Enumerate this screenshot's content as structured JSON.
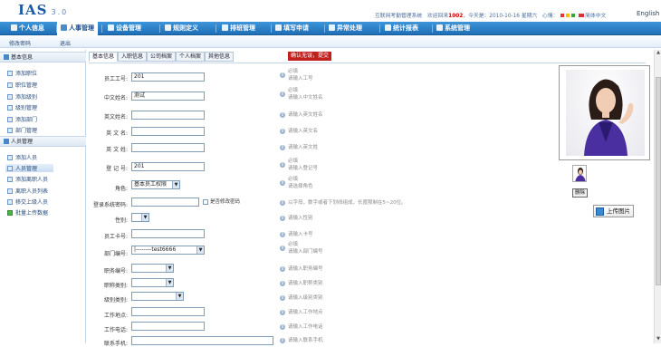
{
  "header": {
    "logo": "IAS",
    "logo_version": "3.0",
    "status_text": "互联网考勤管理系统　欢迎回来",
    "user_id": "1002",
    "status_text2": "，今天是：2010-10-16 星期六　心情：",
    "lang_cn": "简体中文",
    "lang_en": "English"
  },
  "nav": {
    "items": [
      "个人信息",
      "人事管理",
      "设备管理",
      "规则定义",
      "排班管理",
      "填写申请",
      "异常处理",
      "统计报表",
      "系统管理"
    ]
  },
  "subbar": {
    "change_password": "修改密码",
    "logout": "退出"
  },
  "sidebar": {
    "basic_header": "基本信息",
    "basic_items": [
      "添加职位",
      "职位管理",
      "添加级别",
      "级别管理",
      "添加部门",
      "部门管理"
    ],
    "staff_header": "人员管理",
    "staff_items": [
      "添加人员",
      "人员管理",
      "添加离职人员",
      "离职人员列表",
      "移交上级人员",
      "批量上传数据"
    ]
  },
  "tabs": [
    "基本信息",
    "入职信息",
    "公司档案",
    "个人档案",
    "其他信息"
  ],
  "confirm_button": "确认无误，提交",
  "form": {
    "rows": [
      {
        "label": "员工工号:",
        "value": "201",
        "hint1": "必填",
        "hint2": "请输入工号"
      },
      {
        "label": "中文姓名:",
        "value": "测试",
        "hint1": "必填",
        "hint2": "请输入中文姓名"
      },
      {
        "label": "英文姓名:",
        "value": "",
        "hint1": "",
        "hint2": "请输入英文姓名"
      },
      {
        "label": "英 文 名:",
        "value": "",
        "hint1": "",
        "hint2": "请输入英文名"
      },
      {
        "label": "英 文 姓:",
        "value": "",
        "hint1": "",
        "hint2": "请输入英文姓"
      },
      {
        "label": "登 记 号:",
        "value": "201",
        "hint1": "必填",
        "hint2": "请输入登记号"
      },
      {
        "label": "角色:",
        "value": "基本员工权限",
        "hint1": "必填",
        "hint2": "请选择角色"
      },
      {
        "label": "登录系统密码:",
        "value": "",
        "hint1": "",
        "hint2": "以字母，数字或者下划线组成，长度限制在5~20位。"
      },
      {
        "label": "性别:",
        "value": "",
        "hint1": "",
        "hint2": "请输入性别"
      },
      {
        "label": "员工卡号:",
        "value": "",
        "hint1": "",
        "hint2": "请输入卡号"
      },
      {
        "label": "部门编号:",
        "value": "|--------test6666",
        "hint1": "必填",
        "hint2": "请输入部门编号"
      },
      {
        "label": "职务编号:",
        "value": "",
        "hint1": "",
        "hint2": "请输入职务编号"
      },
      {
        "label": "职称类别:",
        "value": "",
        "hint1": "",
        "hint2": "请输入职称类别"
      },
      {
        "label": "级别类别:",
        "value": "",
        "hint1": "",
        "hint2": "请输入级别类别"
      },
      {
        "label": "工作地点:",
        "value": "",
        "hint1": "",
        "hint2": "请输入工作地点"
      },
      {
        "label": "工作电话:",
        "value": "",
        "hint1": "",
        "hint2": "请输入工作电话"
      },
      {
        "label": "联系手机:",
        "value": "",
        "hint1": "",
        "hint2": "请输入联系手机"
      }
    ],
    "change_pwd_label": "是否修改密码"
  },
  "photo": {
    "delete_label": "删除",
    "upload_label": "上传图片"
  }
}
